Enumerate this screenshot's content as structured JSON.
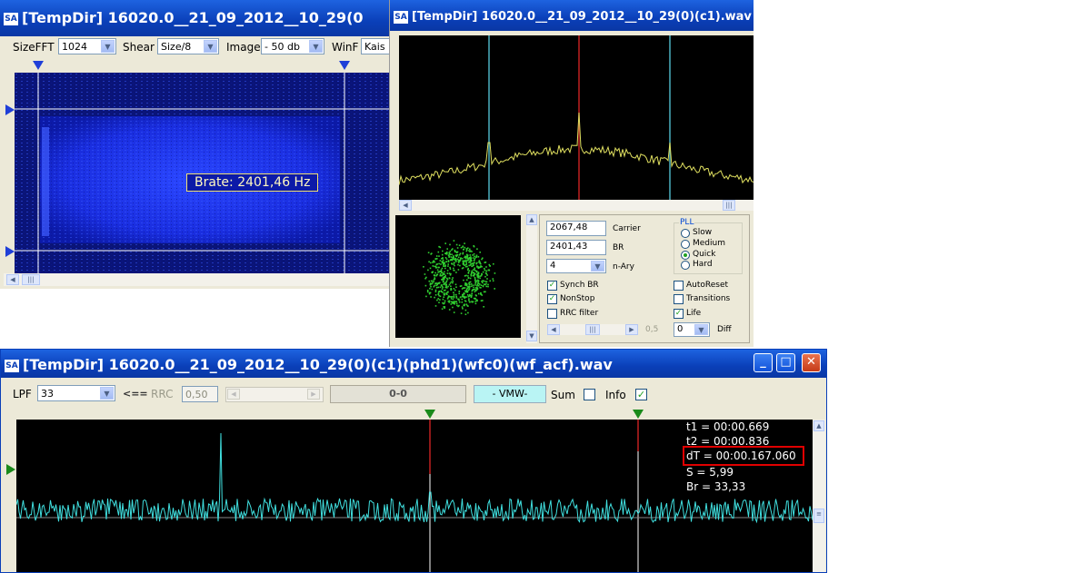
{
  "colors": {
    "title_bar": "#0a3fb8",
    "spectrum_trace": "#e0e060",
    "acf_trace": "#40e0e0",
    "constellation": "#30d030",
    "marker_line_cyan": "#4ab0c0",
    "marker_line_red": "#c02020",
    "dt_highlight": "#e00000"
  },
  "waterfall_window": {
    "title": "[TempDir] 16020.0__21_09_2012__10_29(0",
    "icon": "sa-app-icon",
    "toolbar": {
      "sizefft_label": "SizeFFT",
      "sizefft_value": "1024",
      "shear_label": "Shear",
      "shear_value": "Size/8",
      "image_label": "Image",
      "image_value": "- 50 db",
      "winf_label": "WinF",
      "winf_value": "Kais"
    },
    "brate_label": "Brate: 2401,46 Hz"
  },
  "spectrum_window": {
    "title": "[TempDir] 16020.0__21_09_2012__10_29(0)(c1).wav",
    "icon": "sa-app-icon",
    "carrier_value": "2067,48",
    "carrier_label": "Carrier",
    "br_value": "2401,43",
    "br_label": "BR",
    "nary_value": "4",
    "nary_label": "n-Ary",
    "pll_label": "PLL",
    "pll_options": [
      "Slow",
      "Medium",
      "Quick",
      "Hard"
    ],
    "pll_selected": "Quick",
    "checks": {
      "synch_br": "Synch BR",
      "nonstop": "NonStop",
      "rrc_filter": "RRC filter",
      "autoreset": "AutoReset",
      "transitions": "Transitions",
      "life": "Life"
    },
    "slider_value": "0,5",
    "diff_value": "0",
    "diff_label": "Diff"
  },
  "acf_window": {
    "title": "[TempDir] 16020.0__21_09_2012__10_29(0)(c1)(phd1)(wfc0)(wf_acf).wav",
    "icon": "sa-app-icon",
    "toolbar": {
      "lpf_label": "LPF",
      "lpf_value": "33",
      "arrow_label": "<==",
      "rrc_label": "RRC",
      "rrc_value": "0,50",
      "status_value": "0-0",
      "mode_value": "- VMW-",
      "sum_label": "Sum",
      "info_label": "Info"
    },
    "readout": {
      "t1": "t1 = 00:00.669",
      "t2": "t2 = 00:00.836",
      "dt": "dT = 00:00.167.060",
      "s": "S = 5,99",
      "br": "Br = 33,33"
    }
  }
}
